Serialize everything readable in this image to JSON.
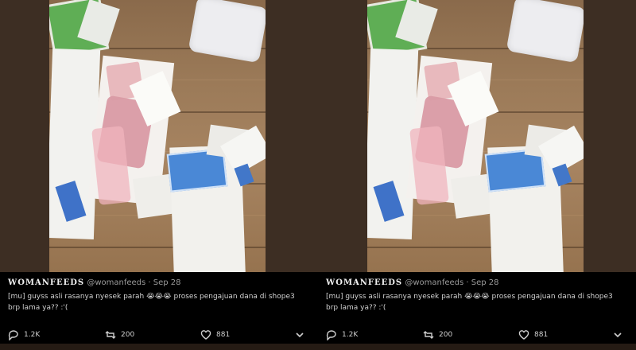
{
  "panels": [
    {
      "tweet": {
        "author_name": "WOMANFEEDS",
        "handle": "@womanfeeds",
        "date": "· Sep 28",
        "text": "[mu] guyss asli rasanya nyesek parah 😭😭😭 proses pengajuan dana di shope3 brp lama ya?? :'(",
        "replies": "1.2K",
        "retweets": "200",
        "likes": "881"
      }
    },
    {
      "tweet": {
        "author_name": "WOMANFEEDS",
        "handle": "@womanfeeds",
        "date": "· Sep 28",
        "text": "[mu] guyss asli rasanya nyesek parah 😭😭😭 proses pengajuan dana di shope3 brp lama ya?? :'(",
        "replies": "1.2K",
        "retweets": "200",
        "likes": "881"
      }
    }
  ],
  "icons": {
    "reply": "comment-icon",
    "retweet": "retweet-icon",
    "like": "heart-icon",
    "more": "chevron-down-icon"
  }
}
